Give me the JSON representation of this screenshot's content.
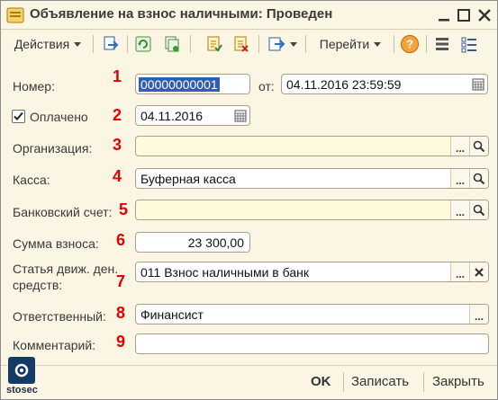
{
  "window": {
    "title": "Объявление на взнос наличными: Проведен"
  },
  "toolbar": {
    "actions_label": "Действия",
    "goto_label": "Перейти"
  },
  "form": {
    "number": {
      "label": "Номер:",
      "marker": "1",
      "value": "00000000001",
      "date_label": "от:",
      "date_value": "04.11.2016 23:59:59"
    },
    "paid": {
      "label": "Оплачено",
      "marker": "2",
      "checked": true,
      "date_value": "04.11.2016"
    },
    "organization": {
      "label": "Организация:",
      "marker": "3",
      "value": ""
    },
    "cashbox": {
      "label": "Касса:",
      "marker": "4",
      "value": "Буферная касса"
    },
    "bank_account": {
      "label": "Банковский счет:",
      "marker": "5",
      "value": ""
    },
    "amount": {
      "label": "Сумма взноса:",
      "marker": "6",
      "value": "23 300,00"
    },
    "cash_flow_item": {
      "label_line1": "Статья движ. ден.",
      "label_line2": "средств:",
      "marker": "7",
      "value": "011 Взнос наличными в банк"
    },
    "responsible": {
      "label": "Ответственный:",
      "marker": "8",
      "value": "Финансист"
    },
    "comment": {
      "label": "Комментарий:",
      "marker": "9",
      "value": ""
    }
  },
  "buttons": {
    "ok": "OK",
    "save": "Записать",
    "close": "Закрыть"
  },
  "watermark": {
    "text": "stosec"
  },
  "colors": {
    "background": "#fbf5e3",
    "marker": "#e00000",
    "selection": "#2e5fb5",
    "yellow_field": "#fffadc"
  }
}
